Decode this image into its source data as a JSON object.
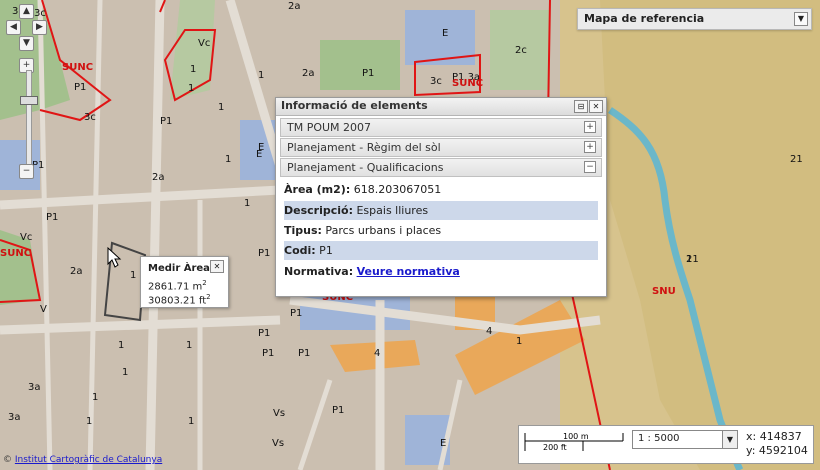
{
  "map": {
    "zone_labels": [
      "3c",
      "3c",
      "2a",
      "E",
      "2c",
      "Vc",
      "SUNC",
      "1",
      "1",
      "2a",
      "P1",
      "3c",
      "P1 3a",
      "SUNC",
      "1",
      "P1",
      "1",
      "3c",
      "P1",
      "E",
      "1",
      "2a",
      "P1",
      "21",
      "Vc",
      "P1",
      "2a",
      "1",
      "E",
      "1",
      "SUNC",
      "P1",
      "1",
      "1",
      "P1",
      "SUNC",
      "21",
      "SNU",
      "V",
      "P1",
      "1",
      "3a",
      "1",
      "1",
      "P1",
      "P1",
      "4",
      "4",
      "1",
      "1",
      "Vs",
      "P1",
      "1",
      "3a",
      "Vs",
      "E",
      "E",
      "1"
    ],
    "colors": {
      "boundary": "#e01515",
      "background": "#cbbfb0",
      "zone_orange": "#e9a85a",
      "zone_blue": "#9fb4d8",
      "park_green": "#a3c08d",
      "river": "#6bb7c9"
    }
  },
  "nav": {
    "pan_up_icon": "▲",
    "pan_left_icon": "◀",
    "pan_right_icon": "▶",
    "pan_down_icon": "▼",
    "zoom_in": "+",
    "zoom_out": "−"
  },
  "reference_map": {
    "title": "Mapa de referencia",
    "dropdown_icon": "▼"
  },
  "info_window": {
    "title": "Informació de elements",
    "sections": [
      {
        "label": "TM POUM 2007",
        "state": "+"
      },
      {
        "label": "Planejament - Règim del sòl",
        "state": "+"
      },
      {
        "label": "Planejament - Qualificacions",
        "state": "−"
      }
    ],
    "fields": [
      {
        "label": "Àrea (m2):",
        "value": " 618.203067051"
      },
      {
        "label": "Descripció:",
        "value": " Espais lliures"
      },
      {
        "label": "Tipus:",
        "value": " Parcs urbans i places"
      },
      {
        "label": "Codi:",
        "value": " P1"
      },
      {
        "label": "Normativa:",
        "link": "Veure normativa"
      }
    ]
  },
  "measure": {
    "title": "Medir Àrea",
    "close_icon": "✕",
    "value_m2": "2861.71 m",
    "value_ft2": "30803.21 ft",
    "exp": "2"
  },
  "scale": {
    "bar_metric": "100 m",
    "bar_imperial": "200 ft",
    "selected": "1 : 5000"
  },
  "coordinates": {
    "x": "x: 414837",
    "y": "y: 4592104"
  },
  "attribution": {
    "prefix": "© ",
    "text": "Institut Cartogràfic de Catalunya"
  }
}
